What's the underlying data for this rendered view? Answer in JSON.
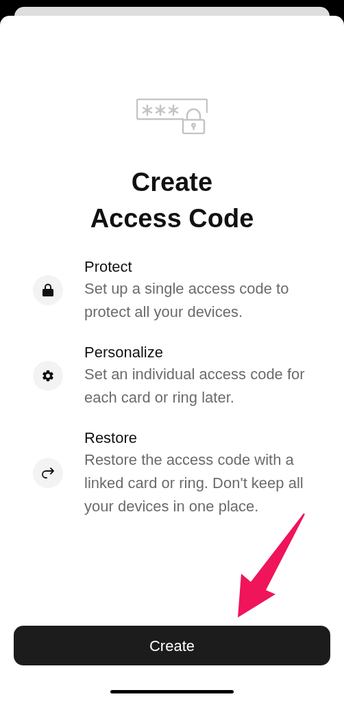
{
  "title_lines": [
    "Create",
    "Access Code"
  ],
  "features": [
    {
      "kind": "lock",
      "title": "Protect",
      "description": "Set up a single access code to protect all your devices."
    },
    {
      "kind": "gear",
      "title": "Personalize",
      "description": "Set an individual access code for each card or ring later."
    },
    {
      "kind": "share",
      "title": "Restore",
      "description": "Restore the access code with a linked card or ring. Don't keep all your devices in one place."
    }
  ],
  "button": "Create"
}
